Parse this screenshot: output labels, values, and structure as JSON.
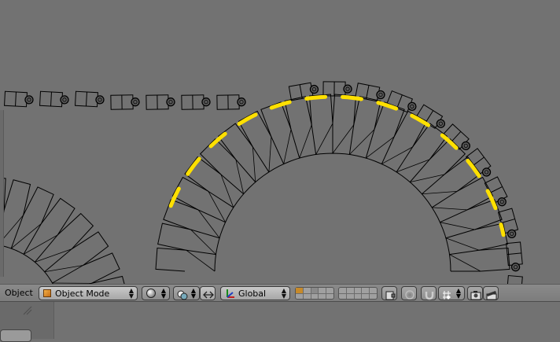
{
  "header": {
    "menu_label": "Object",
    "mode": {
      "value": "Object Mode",
      "icon": "cube-icon"
    },
    "viewport_shading_icon": "sphere-shading-icon",
    "pivot_icon": "pivot-point-icon",
    "manipulator_icon": "transform-manipulator-icon",
    "orientation": {
      "value": "Global",
      "icon": "axis-orientation-icon"
    },
    "layers": {
      "left_block_count": 10,
      "right_block_count": 10
    },
    "lock_icon": "lock-camera-icon",
    "proportional_icon": "proportional-edit-icon",
    "snap_icon": "magnet-snap-icon",
    "snap_target_icon": "snap-target-icon",
    "render_icon": "camera-render-icon",
    "anim_render_icon": "clapperboard-icon"
  },
  "colors": {
    "background": "#727272",
    "wire": "#000000",
    "highlight": "#ffe000"
  }
}
